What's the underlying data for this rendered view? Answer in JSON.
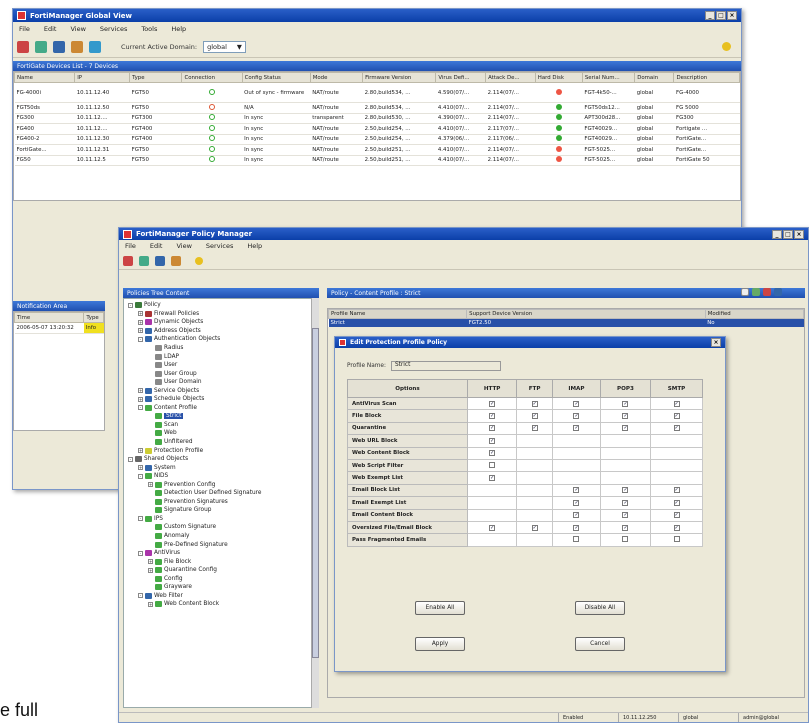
{
  "main_window": {
    "title": "FortiManager Global View",
    "menu": [
      "File",
      "Edit",
      "View",
      "Services",
      "Tools",
      "Help"
    ],
    "active_domain_label": "Current Active Domain:",
    "active_domain_value": "global",
    "help_icon": "help-icon",
    "devices_panel_title": "FortiGate Devices List - 7 Devices",
    "columns": [
      "Name",
      "IP",
      "Type",
      "Connection",
      "Config Status",
      "Mode",
      "Firmware Version",
      "Virus Defi...",
      "Attack De...",
      "Hard Disk",
      "Serial Num...",
      "Domain",
      "Description"
    ],
    "rows": [
      [
        "FG-4000i",
        "10.11.12.40",
        "FGT50",
        "up",
        "Out of sync - firmware",
        "NAT/route",
        "2.80,build534, ...",
        "4.590(07/...",
        "2.114(07/...",
        "red",
        "FGT-4k50-...",
        "global",
        "FG-4000"
      ],
      [
        "FGT50ds",
        "10.11.12.50",
        "FGT50",
        "down",
        "N/A",
        "NAT/route",
        "2.80,build534, ...",
        "4.410(07/...",
        "2.114(07/...",
        "green",
        "FGT50ds12...",
        "global",
        "FG 5000"
      ],
      [
        "FG300",
        "10.11.12....",
        "FGT300",
        "up",
        "In sync",
        "transparent",
        "2.80,build530, ...",
        "4.390(07/...",
        "2.114(07/...",
        "green",
        "APT300d28...",
        "global",
        "FG300"
      ],
      [
        "FG400",
        "10.11.12....",
        "FGT400",
        "up",
        "In sync",
        "NAT/route",
        "2.50,build254, ...",
        "4.410(07/...",
        "2.117(07/...",
        "green",
        "FGT40029...",
        "global",
        "Fortigate ..."
      ],
      [
        "FG400-2",
        "10.11.12.30",
        "FGT400",
        "up",
        "In sync",
        "NAT/route",
        "2.50,build254, ...",
        "4.379(06/...",
        "2.117(06/...",
        "green",
        "FGT40029...",
        "global",
        "FortiGate..."
      ],
      [
        "FortiGate...",
        "10.11.12.31",
        "FGT50",
        "up",
        "In sync",
        "NAT/route",
        "2.50,build251, ...",
        "4.410(07/...",
        "2.114(07/...",
        "red",
        "FGT-5025...",
        "global",
        "FortiGate..."
      ],
      [
        "FG50",
        "10.11.12.5",
        "FGT50",
        "up",
        "In sync",
        "NAT/route",
        "2.50,build251, ...",
        "4.410(07/...",
        "2.114(07/...",
        "red",
        "FGT-5025...",
        "global",
        "FortiGate 50"
      ]
    ],
    "notif_title": "Notification Area",
    "notif_columns": [
      "Time",
      "Type"
    ],
    "notif_row": [
      "2006-05-07 13:20:32",
      "Info"
    ]
  },
  "policy_window": {
    "title": "FortiManager Policy Manager",
    "menu": [
      "File",
      "Edit",
      "View",
      "Services",
      "Help"
    ],
    "tree_title": "Policies Tree Content",
    "tree": [
      {
        "label": "Policy",
        "indent": 0,
        "pm": "-",
        "icon": "#3a7a3a"
      },
      {
        "label": "Firewall Policies",
        "indent": 1,
        "pm": "+",
        "icon": "#a33"
      },
      {
        "label": "Dynamic Objects",
        "indent": 1,
        "pm": "+",
        "icon": "#a3a"
      },
      {
        "label": "Address Objects",
        "indent": 1,
        "pm": "+",
        "icon": "#36a"
      },
      {
        "label": "Authentication Objects",
        "indent": 1,
        "pm": "-",
        "icon": "#36a"
      },
      {
        "label": "Radius",
        "indent": 2,
        "pm": "",
        "icon": "#888"
      },
      {
        "label": "LDAP",
        "indent": 2,
        "pm": "",
        "icon": "#888"
      },
      {
        "label": "User",
        "indent": 2,
        "pm": "",
        "icon": "#888"
      },
      {
        "label": "User Group",
        "indent": 2,
        "pm": "",
        "icon": "#888"
      },
      {
        "label": "User Domain",
        "indent": 2,
        "pm": "",
        "icon": "#888"
      },
      {
        "label": "Service Objects",
        "indent": 1,
        "pm": "+",
        "icon": "#36a"
      },
      {
        "label": "Schedule Objects",
        "indent": 1,
        "pm": "+",
        "icon": "#36a"
      },
      {
        "label": "Content Profile",
        "indent": 1,
        "pm": "-",
        "icon": "#4a4"
      },
      {
        "label": "Strict",
        "indent": 2,
        "pm": "",
        "icon": "#4a4",
        "sel": true
      },
      {
        "label": "Scan",
        "indent": 2,
        "pm": "",
        "icon": "#4a4"
      },
      {
        "label": "Web",
        "indent": 2,
        "pm": "",
        "icon": "#4a4"
      },
      {
        "label": "Unfiltered",
        "indent": 2,
        "pm": "",
        "icon": "#4a4"
      },
      {
        "label": "Protection Profile",
        "indent": 1,
        "pm": "+",
        "icon": "#cc3"
      },
      {
        "label": "Shared Objects",
        "indent": 0,
        "pm": "-",
        "icon": "#666"
      },
      {
        "label": "System",
        "indent": 1,
        "pm": "+",
        "icon": "#36a"
      },
      {
        "label": "NIDS",
        "indent": 1,
        "pm": "-",
        "icon": "#4a4"
      },
      {
        "label": "Prevention Config",
        "indent": 2,
        "pm": "+",
        "icon": "#4a4"
      },
      {
        "label": "Detection User Defined Signature",
        "indent": 2,
        "pm": "",
        "icon": "#4a4"
      },
      {
        "label": "Prevention Signatures",
        "indent": 2,
        "pm": "",
        "icon": "#4a4"
      },
      {
        "label": "Signature Group",
        "indent": 2,
        "pm": "",
        "icon": "#4a4"
      },
      {
        "label": "IPS",
        "indent": 1,
        "pm": "-",
        "icon": "#4a4"
      },
      {
        "label": "Custom Signature",
        "indent": 2,
        "pm": "",
        "icon": "#4a4"
      },
      {
        "label": "Anomaly",
        "indent": 2,
        "pm": "",
        "icon": "#4a4"
      },
      {
        "label": "Pre-Defined Signature",
        "indent": 2,
        "pm": "",
        "icon": "#4a4"
      },
      {
        "label": "AntiVirus",
        "indent": 1,
        "pm": "-",
        "icon": "#a3a"
      },
      {
        "label": "File Block",
        "indent": 2,
        "pm": "+",
        "icon": "#4a4"
      },
      {
        "label": "Quarantine Config",
        "indent": 2,
        "pm": "+",
        "icon": "#4a4"
      },
      {
        "label": "Config",
        "indent": 2,
        "pm": "",
        "icon": "#4a4"
      },
      {
        "label": "Grayware",
        "indent": 2,
        "pm": "",
        "icon": "#4a4"
      },
      {
        "label": "Web Filter",
        "indent": 1,
        "pm": "-",
        "icon": "#36a"
      },
      {
        "label": "Web Content Block",
        "indent": 2,
        "pm": "+",
        "icon": "#4a4"
      }
    ],
    "right_title": "Policy - Content Profile : Strict",
    "profile_columns": [
      "Profile Name",
      "Support Device Version",
      "Modified"
    ],
    "profile_row": [
      "Strict",
      "FGT2.50",
      "No"
    ],
    "status": [
      "Enabled",
      "10.11.12.250",
      "global",
      "admin@global"
    ]
  },
  "dialog": {
    "title": "Edit Protection Profile Policy",
    "profile_name_label": "Profile Name:",
    "profile_name_value": "Strict",
    "headers": [
      "Options",
      "HTTP",
      "FTP",
      "IMAP",
      "POP3",
      "SMTP"
    ],
    "rows": [
      {
        "name": "AntiVirus Scan",
        "c": [
          1,
          1,
          1,
          1,
          1
        ]
      },
      {
        "name": "File Block",
        "c": [
          1,
          1,
          1,
          1,
          1
        ]
      },
      {
        "name": "Quarantine",
        "c": [
          1,
          1,
          1,
          1,
          1
        ]
      },
      {
        "name": "Web URL Block",
        "c": [
          1,
          -1,
          -1,
          -1,
          -1
        ]
      },
      {
        "name": "Web Content Block",
        "c": [
          1,
          -1,
          -1,
          -1,
          -1
        ]
      },
      {
        "name": "Web Script Filter",
        "c": [
          0,
          -1,
          -1,
          -1,
          -1
        ]
      },
      {
        "name": "Web Exempt List",
        "c": [
          1,
          -1,
          -1,
          -1,
          -1
        ]
      },
      {
        "name": "Email Block List",
        "c": [
          -1,
          -1,
          1,
          1,
          1
        ]
      },
      {
        "name": "Email Exempt List",
        "c": [
          -1,
          -1,
          1,
          1,
          1
        ]
      },
      {
        "name": "Email Content Block",
        "c": [
          -1,
          -1,
          1,
          1,
          1
        ]
      },
      {
        "name": "Oversized File/Email Block",
        "c": [
          1,
          1,
          1,
          1,
          1
        ]
      },
      {
        "name": "Pass Fragmented Emails",
        "c": [
          -1,
          -1,
          0,
          0,
          0
        ]
      }
    ],
    "enable_all": "Enable All",
    "disable_all": "Disable All",
    "apply": "Apply",
    "cancel": "Cancel"
  },
  "footer_fragment": "e full"
}
